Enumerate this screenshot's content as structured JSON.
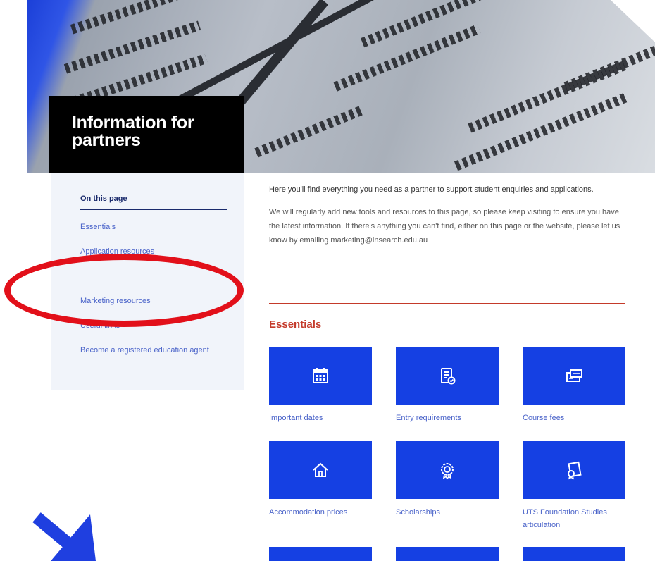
{
  "hero": {
    "title": "Information for partners"
  },
  "sidebar": {
    "heading": "On this page",
    "items": [
      "Essentials",
      "Application resources",
      "Marketing resources",
      "Useful links",
      "Become a registered education agent"
    ]
  },
  "main": {
    "intro": "Here you'll find everything you need as a partner to support student enquiries and applications.",
    "intro2": "We will regularly add new tools and resources to this page, so please keep visiting to ensure you have the latest information. If there's anything you can't find, either on this page or the website, please let us know by emailing marketing@insearch.edu.au",
    "section_title": "Essentials",
    "tiles": [
      {
        "label": "Important dates",
        "icon": "calendar-icon"
      },
      {
        "label": "Entry requirements",
        "icon": "document-check-icon"
      },
      {
        "label": "Course fees",
        "icon": "fees-icon"
      },
      {
        "label": "Accommodation prices",
        "icon": "house-icon"
      },
      {
        "label": "Scholarships",
        "icon": "badge-icon"
      },
      {
        "label": "UTS Foundation Studies articulation",
        "icon": "certificate-icon"
      }
    ]
  },
  "colors": {
    "tile_blue": "#1540e3",
    "accent_red": "#c43a2a",
    "link_blue": "#4a63c9",
    "annotation_red": "#e2101a",
    "annotation_blue": "#1f3fe0"
  }
}
